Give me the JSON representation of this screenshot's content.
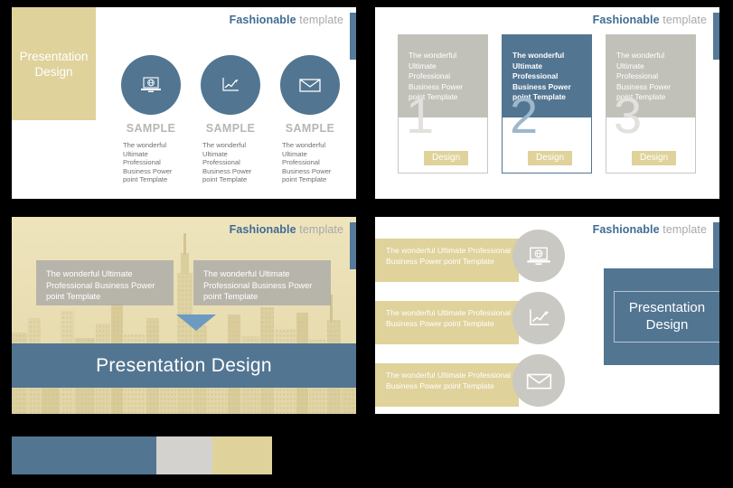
{
  "brand": {
    "bold": "Fashionable",
    "light": "template"
  },
  "colors": {
    "blue": "#527591",
    "khaki": "#dfd29b",
    "grey": "#c2c1b9",
    "swatch_grey": "#d3d2ce",
    "number_grey": "#e2e1dd",
    "number_blue": "#9db8cd"
  },
  "slide1": {
    "title": "Presentation\nDesign",
    "title_line1": "Presentation",
    "title_line2": "Design",
    "columns": [
      {
        "icon": "laptop-globe-icon",
        "heading": "SAMPLE",
        "body": "The wonderful Ultimate Professional Business Power point Template"
      },
      {
        "icon": "line-chart-icon",
        "heading": "SAMPLE",
        "body": "The wonderful Ultimate Professional Business Power point Template"
      },
      {
        "icon": "envelope-icon",
        "heading": "SAMPLE",
        "body": "The wonderful Ultimate Professional Business Power point Template"
      }
    ]
  },
  "slide2": {
    "columns": [
      {
        "body": "The wonderful Ultimate Professional Business Power point Template",
        "number": "1",
        "button": "Design",
        "active": false
      },
      {
        "body": "The wonderful Ultimate Professional Business Power point Template",
        "number": "2",
        "button": "Design",
        "active": true
      },
      {
        "body": "The wonderful Ultimate Professional Business Power point Template",
        "number": "3",
        "button": "Design",
        "active": false
      }
    ]
  },
  "slide3": {
    "boxes": [
      {
        "body": "The wonderful Ultimate Professional Business Power point Template"
      },
      {
        "body": "The wonderful Ultimate Professional Business Power point Template"
      }
    ],
    "banner": "Presentation Design",
    "arrow": "down-triangle-icon",
    "background": "city-skyline-image"
  },
  "slide4": {
    "rows": [
      {
        "body": "The wonderful Ultimate Professional Business Power point Template",
        "icon": "laptop-globe-icon"
      },
      {
        "body": "The wonderful Ultimate Professional Business Power point Template",
        "icon": "line-chart-icon"
      },
      {
        "body": "The wonderful Ultimate Professional Business Power point Template",
        "icon": "envelope-icon"
      }
    ],
    "panel_line1": "Presentation",
    "panel_line2": "Design"
  },
  "swatches": [
    {
      "name": "blue-swatch",
      "color": "#527591"
    },
    {
      "name": "grey-swatch",
      "color": "#d3d2ce"
    },
    {
      "name": "khaki-swatch",
      "color": "#dfd29b"
    }
  ]
}
